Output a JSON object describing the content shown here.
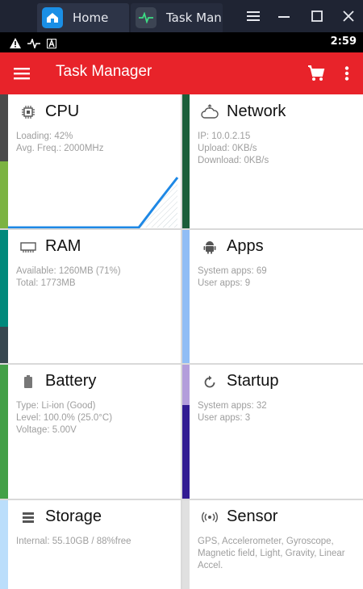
{
  "window": {
    "tabs": [
      {
        "label": "Home"
      },
      {
        "label": "Task Man"
      }
    ]
  },
  "statusbar": {
    "time": "2:59"
  },
  "toolbar": {
    "title": "Task Manager"
  },
  "cards": {
    "cpu": {
      "title": "CPU",
      "lines": [
        "Loading: 42%",
        "Avg. Freq.: 2000MHz"
      ]
    },
    "network": {
      "title": "Network",
      "lines": [
        "IP: 10.0.2.15",
        "Upload: 0KB/s",
        "Download: 0KB/s"
      ]
    },
    "ram": {
      "title": "RAM",
      "lines": [
        "Available: 1260MB (71%)",
        "Total: 1773MB"
      ]
    },
    "apps": {
      "title": "Apps",
      "lines": [
        "System apps: 69",
        "User apps: 9"
      ]
    },
    "battery": {
      "title": "Battery",
      "lines": [
        "Type: Li-ion (Good)",
        "Level: 100.0% (25.0°C)",
        "Voltage: 5.00V"
      ]
    },
    "startup": {
      "title": "Startup",
      "lines": [
        "System apps: 32",
        "User apps: 3"
      ]
    },
    "storage": {
      "title": "Storage",
      "lines": [
        "Internal: 55.10GB / 88%free"
      ]
    },
    "sensor": {
      "title": "Sensor",
      "lines": [
        "GPS, Accelerometer, Gyroscope,",
        "Magnetic field, Light, Gravity, Linear",
        "Accel."
      ]
    }
  },
  "colors": {
    "toolbar": "#e8232a",
    "cpu_graph": "#1e88e5"
  },
  "icons": {
    "cpu": "cpu-chip-icon",
    "network": "cloud-network-icon",
    "ram": "memory-chip-icon",
    "apps": "android-icon",
    "battery": "battery-icon",
    "startup": "restart-icon",
    "storage": "storage-list-icon",
    "sensor": "sensor-waves-icon"
  }
}
